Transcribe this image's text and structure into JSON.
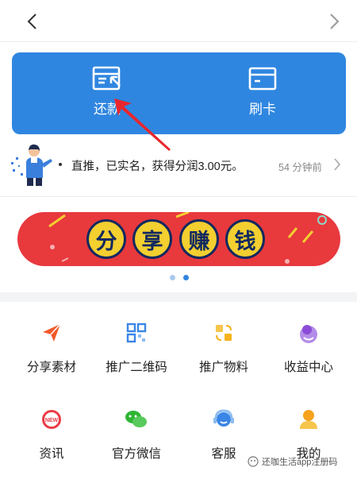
{
  "nav": {
    "back_icon": "chevron-left-icon",
    "forward_icon": "chevron-right-icon"
  },
  "card": {
    "bg_color": "#2f86e0",
    "actions": [
      {
        "label": "还款",
        "icon": "repay-card-icon"
      },
      {
        "label": "刷卡",
        "icon": "swipe-card-icon"
      }
    ]
  },
  "notice": {
    "text": "直推，已实名，获得分润3.00元。",
    "time": "54 分钟前",
    "icon": "presenter-icon"
  },
  "banner": {
    "chars": [
      "分",
      "享",
      "赚",
      "钱"
    ],
    "bg_color": "#e8393d",
    "accent_color": "#f3cf30",
    "page_count": 2
  },
  "grid": [
    {
      "label": "分享素材",
      "icon": "paper-plane-icon",
      "color": "#f15a2b"
    },
    {
      "label": "推广二维码",
      "icon": "qrcode-icon",
      "color": "#3a86e6"
    },
    {
      "label": "推广物料",
      "icon": "materials-icon",
      "color": "#f6b31c"
    },
    {
      "label": "收益中心",
      "icon": "income-icon",
      "color": "#8b4bd8"
    },
    {
      "label": "资讯",
      "icon": "news-icon",
      "color": "#ea3b44",
      "badge": "NEW"
    },
    {
      "label": "官方微信",
      "icon": "wechat-icon",
      "color": "#2fb534"
    },
    {
      "label": "客服",
      "icon": "customer-service-icon",
      "color": "#3a86e6"
    },
    {
      "label": "我的",
      "icon": "user-icon",
      "color": "#f6a21c"
    }
  ],
  "watermark": {
    "text": "还咖生活app注册码"
  }
}
